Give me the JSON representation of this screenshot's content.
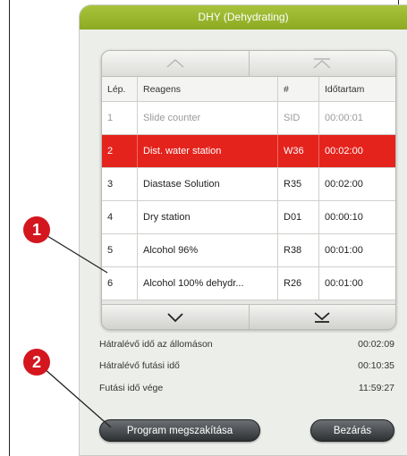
{
  "window": {
    "title": "DHY (Dehydrating)"
  },
  "table": {
    "headers": [
      "Lép.",
      "Reagens",
      "#",
      "Időtartam"
    ],
    "rows": [
      {
        "step": "1",
        "reagent": "Slide counter",
        "code": "SID",
        "duration": "00:00:01",
        "state": "dimmed"
      },
      {
        "step": "2",
        "reagent": "Dist. water station",
        "code": "W36",
        "duration": "00:02:00",
        "state": "selected"
      },
      {
        "step": "3",
        "reagent": "Diastase Solution",
        "code": "R35",
        "duration": "00:02:00",
        "state": "normal"
      },
      {
        "step": "4",
        "reagent": "Dry station",
        "code": "D01",
        "duration": "00:00:10",
        "state": "normal"
      },
      {
        "step": "5",
        "reagent": "Alcohol 96%",
        "code": "R38",
        "duration": "00:01:00",
        "state": "normal"
      },
      {
        "step": "6",
        "reagent": "Alcohol 100% dehydr...",
        "code": "R26",
        "duration": "00:01:00",
        "state": "normal"
      }
    ],
    "selected_color": "#e4231c"
  },
  "info": {
    "remaining_station_label": "Hátralévő idő az állomáson",
    "remaining_station_value": "00:02:09",
    "remaining_run_label": "Hátralévő futási idő",
    "remaining_run_value": "00:10:35",
    "end_time_label": "Futási idő vége",
    "end_time_value": "11:59:27"
  },
  "buttons": {
    "abort": "Program megszakítása",
    "close": "Bezárás"
  },
  "callouts": [
    "1",
    "2"
  ],
  "colors": {
    "title_bar": "#9bb530",
    "callout": "#d4161f"
  }
}
